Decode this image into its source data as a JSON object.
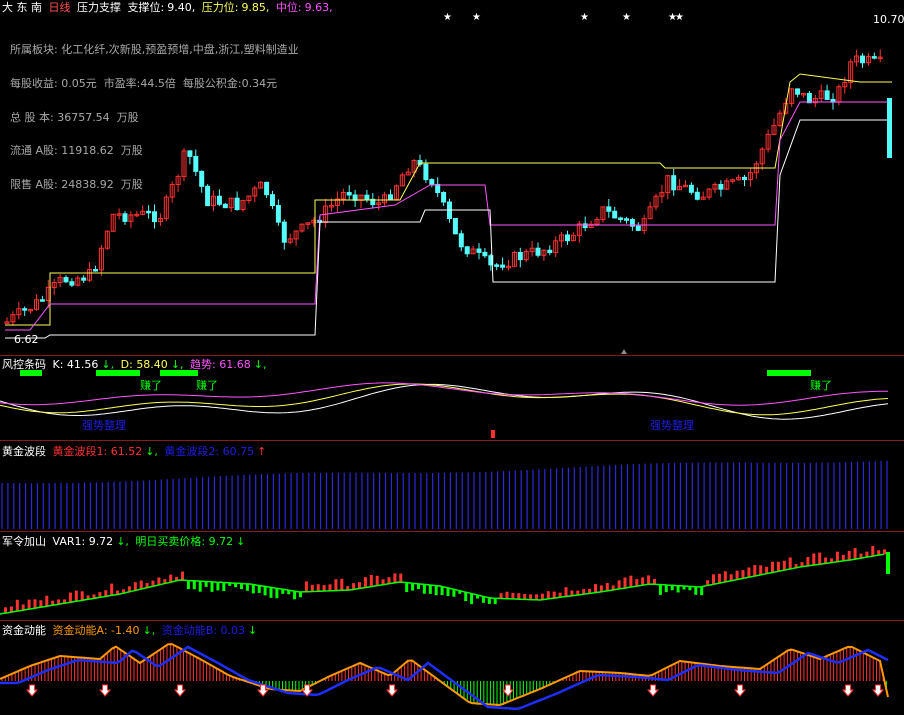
{
  "title_bar": {
    "stock_name": "大 东 南",
    "period": "日线",
    "indicator": "压力支撑",
    "support_label": "支撑位:",
    "support_value": "9.40,",
    "pressure_label": "压力位:",
    "pressure_value": "9.85,",
    "mid_label": "中位:",
    "mid_value": "9.63,"
  },
  "stock_info": [
    "所属板块: 化工化纤,次新股,预盈预增,中盘,浙江,塑料制造业",
    "每股收益: 0.05元  市盈率:44.5倍  每股公积金:0.34元",
    "总 股 本: 36757.54  万股",
    "流通 A股: 11918.62  万股",
    "限售 A股: 24838.92  万股"
  ],
  "price_labels": {
    "high": "10.70",
    "low": "6.62"
  },
  "panel2": {
    "name": "风控条码",
    "k_label": "K: 41.56",
    "d_label": "D: 58.40",
    "trend_label": "趋势: 61.68",
    "signals": [
      "赚了",
      "赚了",
      "赚了"
    ],
    "zones": [
      "强势整理",
      "强势整理"
    ]
  },
  "panel3": {
    "name": "黄金波段",
    "b1_label": "黄金波段1: 61.52",
    "b2_label": "黄金波段2: 60.75"
  },
  "panel4": {
    "name": "军令加山",
    "var_label": "VAR1: 9.72",
    "next_label": "明日买卖价格: 9.72"
  },
  "panel5": {
    "name": "资金动能",
    "a_label": "资金动能A: -1.40",
    "b_label": "资金动能B: 0.03"
  },
  "colors": {
    "up": "#ff3232",
    "down": "#54fcfc",
    "yellow": "#ffff54",
    "magenta": "#ff54ff",
    "white": "#ffffff",
    "green": "#00ff00",
    "blue": "#0000ff",
    "darkblue": "#1e1ee6",
    "orange": "#ff9900",
    "separator": "#8b1a1a"
  }
}
